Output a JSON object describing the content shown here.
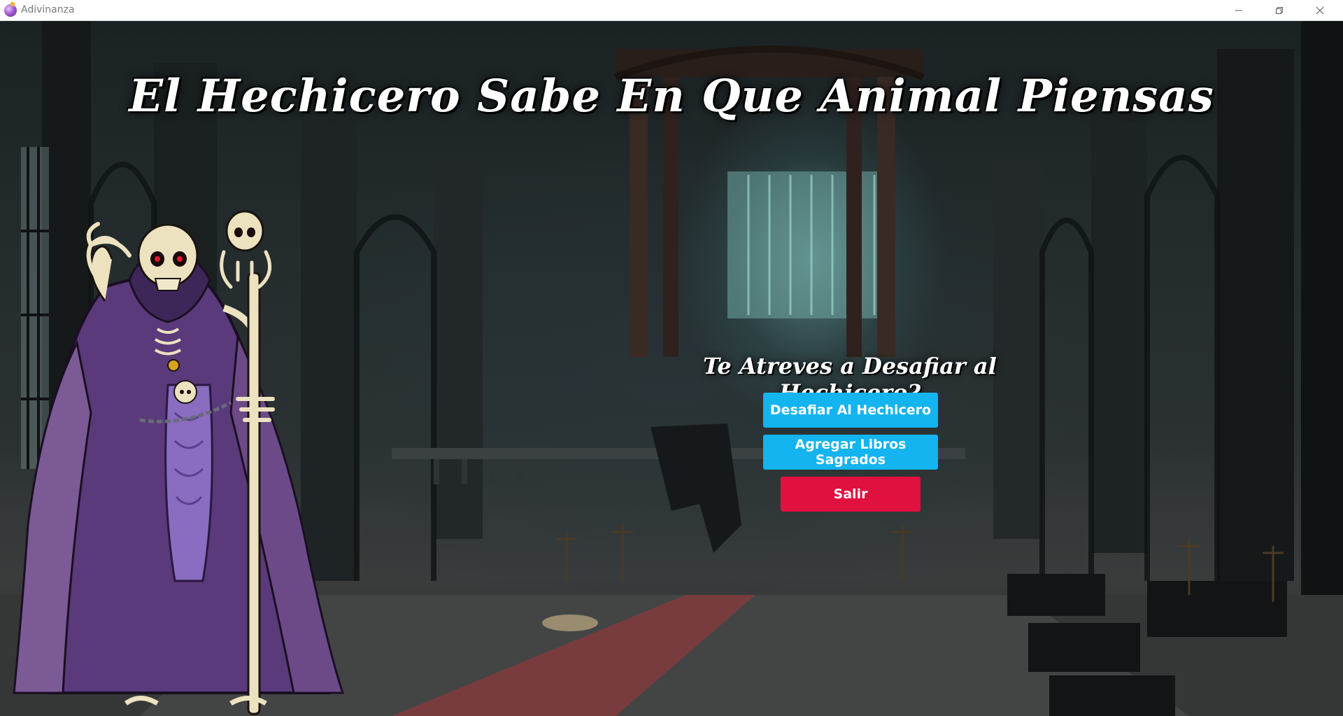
{
  "window": {
    "title": "Adivinanza",
    "icon": "crystal-ball-icon",
    "controls": [
      "minimize-icon",
      "restore-icon",
      "close-icon"
    ]
  },
  "main": {
    "title": "El Hechicero Sabe En Que Animal Piensas",
    "prompt": "Te Atreves a Desafiar al Hechicero?",
    "buttons": {
      "challenge": "Desafiar Al Hechicero",
      "add_books": "Agregar Libros Sagrados",
      "exit": "Salir"
    }
  },
  "colors": {
    "primary_button": "#13b4ef",
    "danger_button": "#e0103f",
    "title_text": "#ffffff"
  }
}
